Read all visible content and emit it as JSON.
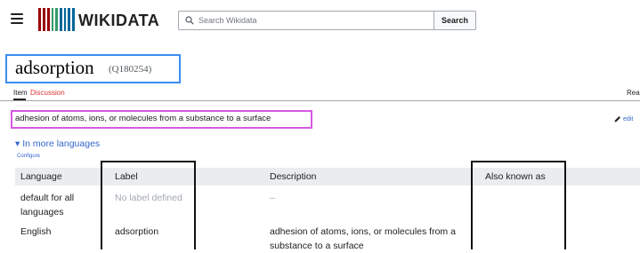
{
  "header": {
    "logo_text": "WIKIDATA",
    "search_placeholder": "Search Wikidata",
    "search_button": "Search"
  },
  "item": {
    "label": "adsorption",
    "id": "(Q180254)",
    "description": "adhesion of atoms, ions, or molecules from a substance to a surface"
  },
  "tabs": {
    "item": "Item",
    "discussion": "Discussion",
    "read": "Rea"
  },
  "edit_label": "edit",
  "languages": {
    "toggle": "▾ In more languages",
    "configure": "Configure",
    "columns": [
      "Language",
      "Label",
      "Description",
      "Also known as"
    ],
    "rows": [
      {
        "language": "default for all languages",
        "label": "No label defined",
        "description": "–",
        "aliases": ""
      },
      {
        "language": "English",
        "label": "adsorption",
        "description": "adhesion of atoms, ions, or molecules from a substance to a surface",
        "aliases": ""
      }
    ]
  },
  "colors": {
    "title_highlight": "#3b8ef0",
    "description_highlight": "#d659e0",
    "link": "#36c",
    "discussion_tab": "#d33",
    "logo_bars": [
      "#990000",
      "#339966",
      "#006699"
    ]
  },
  "icons": [
    "menu-icon",
    "wikidata-logo",
    "search-icon",
    "pencil-icon"
  ]
}
